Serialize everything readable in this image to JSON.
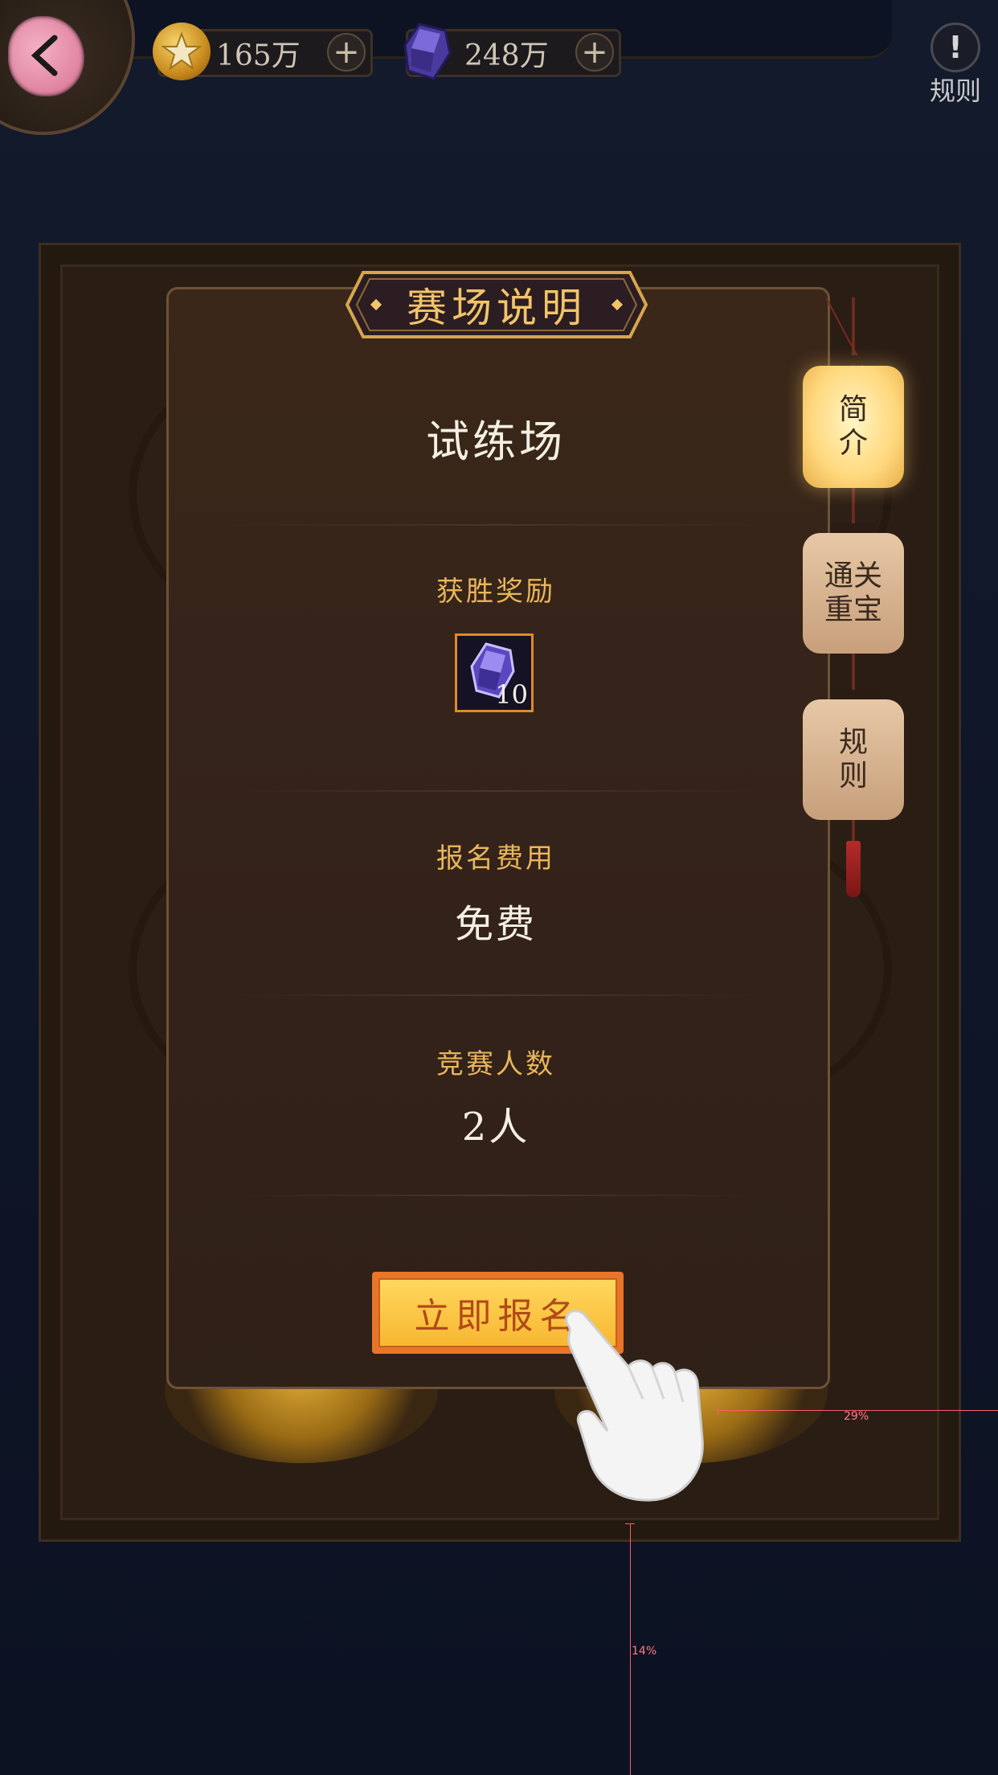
{
  "topbar": {
    "gold": {
      "value": "165万",
      "icon": "star-coin-icon"
    },
    "gems": {
      "value": "248万",
      "icon": "purple-gem-icon"
    },
    "rules_label": "规则"
  },
  "panel": {
    "title": "赛场说明",
    "arena_name": "试练场",
    "reward": {
      "label": "获胜奖励",
      "item_icon": "purple-gem-icon",
      "count": "10"
    },
    "fee": {
      "label": "报名费用",
      "value": "免费"
    },
    "players": {
      "label": "竞赛人数",
      "value": "2人"
    },
    "signup_label": "立即报名"
  },
  "tabs": [
    {
      "label_line1": "简",
      "label_line2": "介",
      "active": true
    },
    {
      "label_line1": "通关",
      "label_line2": "重宝",
      "active": false
    },
    {
      "label_line1": "规",
      "label_line2": "则",
      "active": false
    }
  ],
  "guides": {
    "horizontal_label": "29%",
    "vertical_label": "14%"
  },
  "colors": {
    "accent_gold": "#f2c46a",
    "button": "#f7b731",
    "panel": "#33221a"
  }
}
